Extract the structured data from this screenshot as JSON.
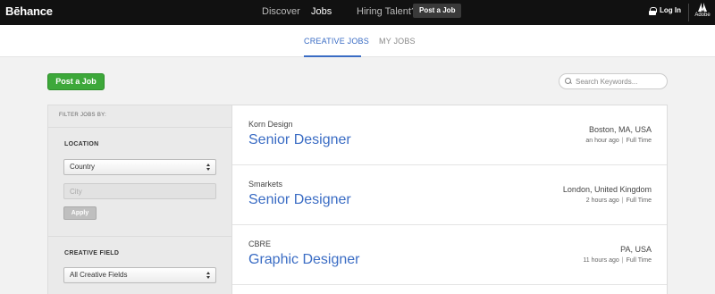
{
  "topbar": {
    "logo": "Bēhance",
    "nav": [
      {
        "label": "Discover"
      },
      {
        "label": "Jobs"
      },
      {
        "label": "Hiring Talent?"
      }
    ],
    "post_job_label": "Post a Job",
    "login_label": "Log In",
    "adobe_label": "Adobe"
  },
  "tabs": [
    {
      "label": "CREATIVE JOBS",
      "active": true
    },
    {
      "label": "MY JOBS",
      "active": false
    }
  ],
  "actions": {
    "post_job_label": "Post a Job",
    "search_placeholder": "Search Keywords..."
  },
  "filters": {
    "header": "FILTER JOBS BY:",
    "location": {
      "label": "LOCATION",
      "country_value": "Country",
      "city_placeholder": "City",
      "apply_label": "Apply"
    },
    "creative_field": {
      "label": "CREATIVE FIELD",
      "value": "All Creative Fields"
    }
  },
  "jobs": [
    {
      "company": "Korn Design",
      "title": "Senior Designer",
      "location": "Boston, MA, USA",
      "posted": "an hour ago",
      "type": "Full Time"
    },
    {
      "company": "Smarkets",
      "title": "Senior Designer",
      "location": "London, United Kingdom",
      "posted": "2 hours ago",
      "type": "Full Time"
    },
    {
      "company": "CBRE",
      "title": "Graphic Designer",
      "location": "PA, USA",
      "posted": "11 hours ago",
      "type": "Full Time"
    }
  ],
  "colors": {
    "accent_blue": "#3a6cc4",
    "post_green": "#3da83a",
    "topbar_bg": "#111111"
  }
}
